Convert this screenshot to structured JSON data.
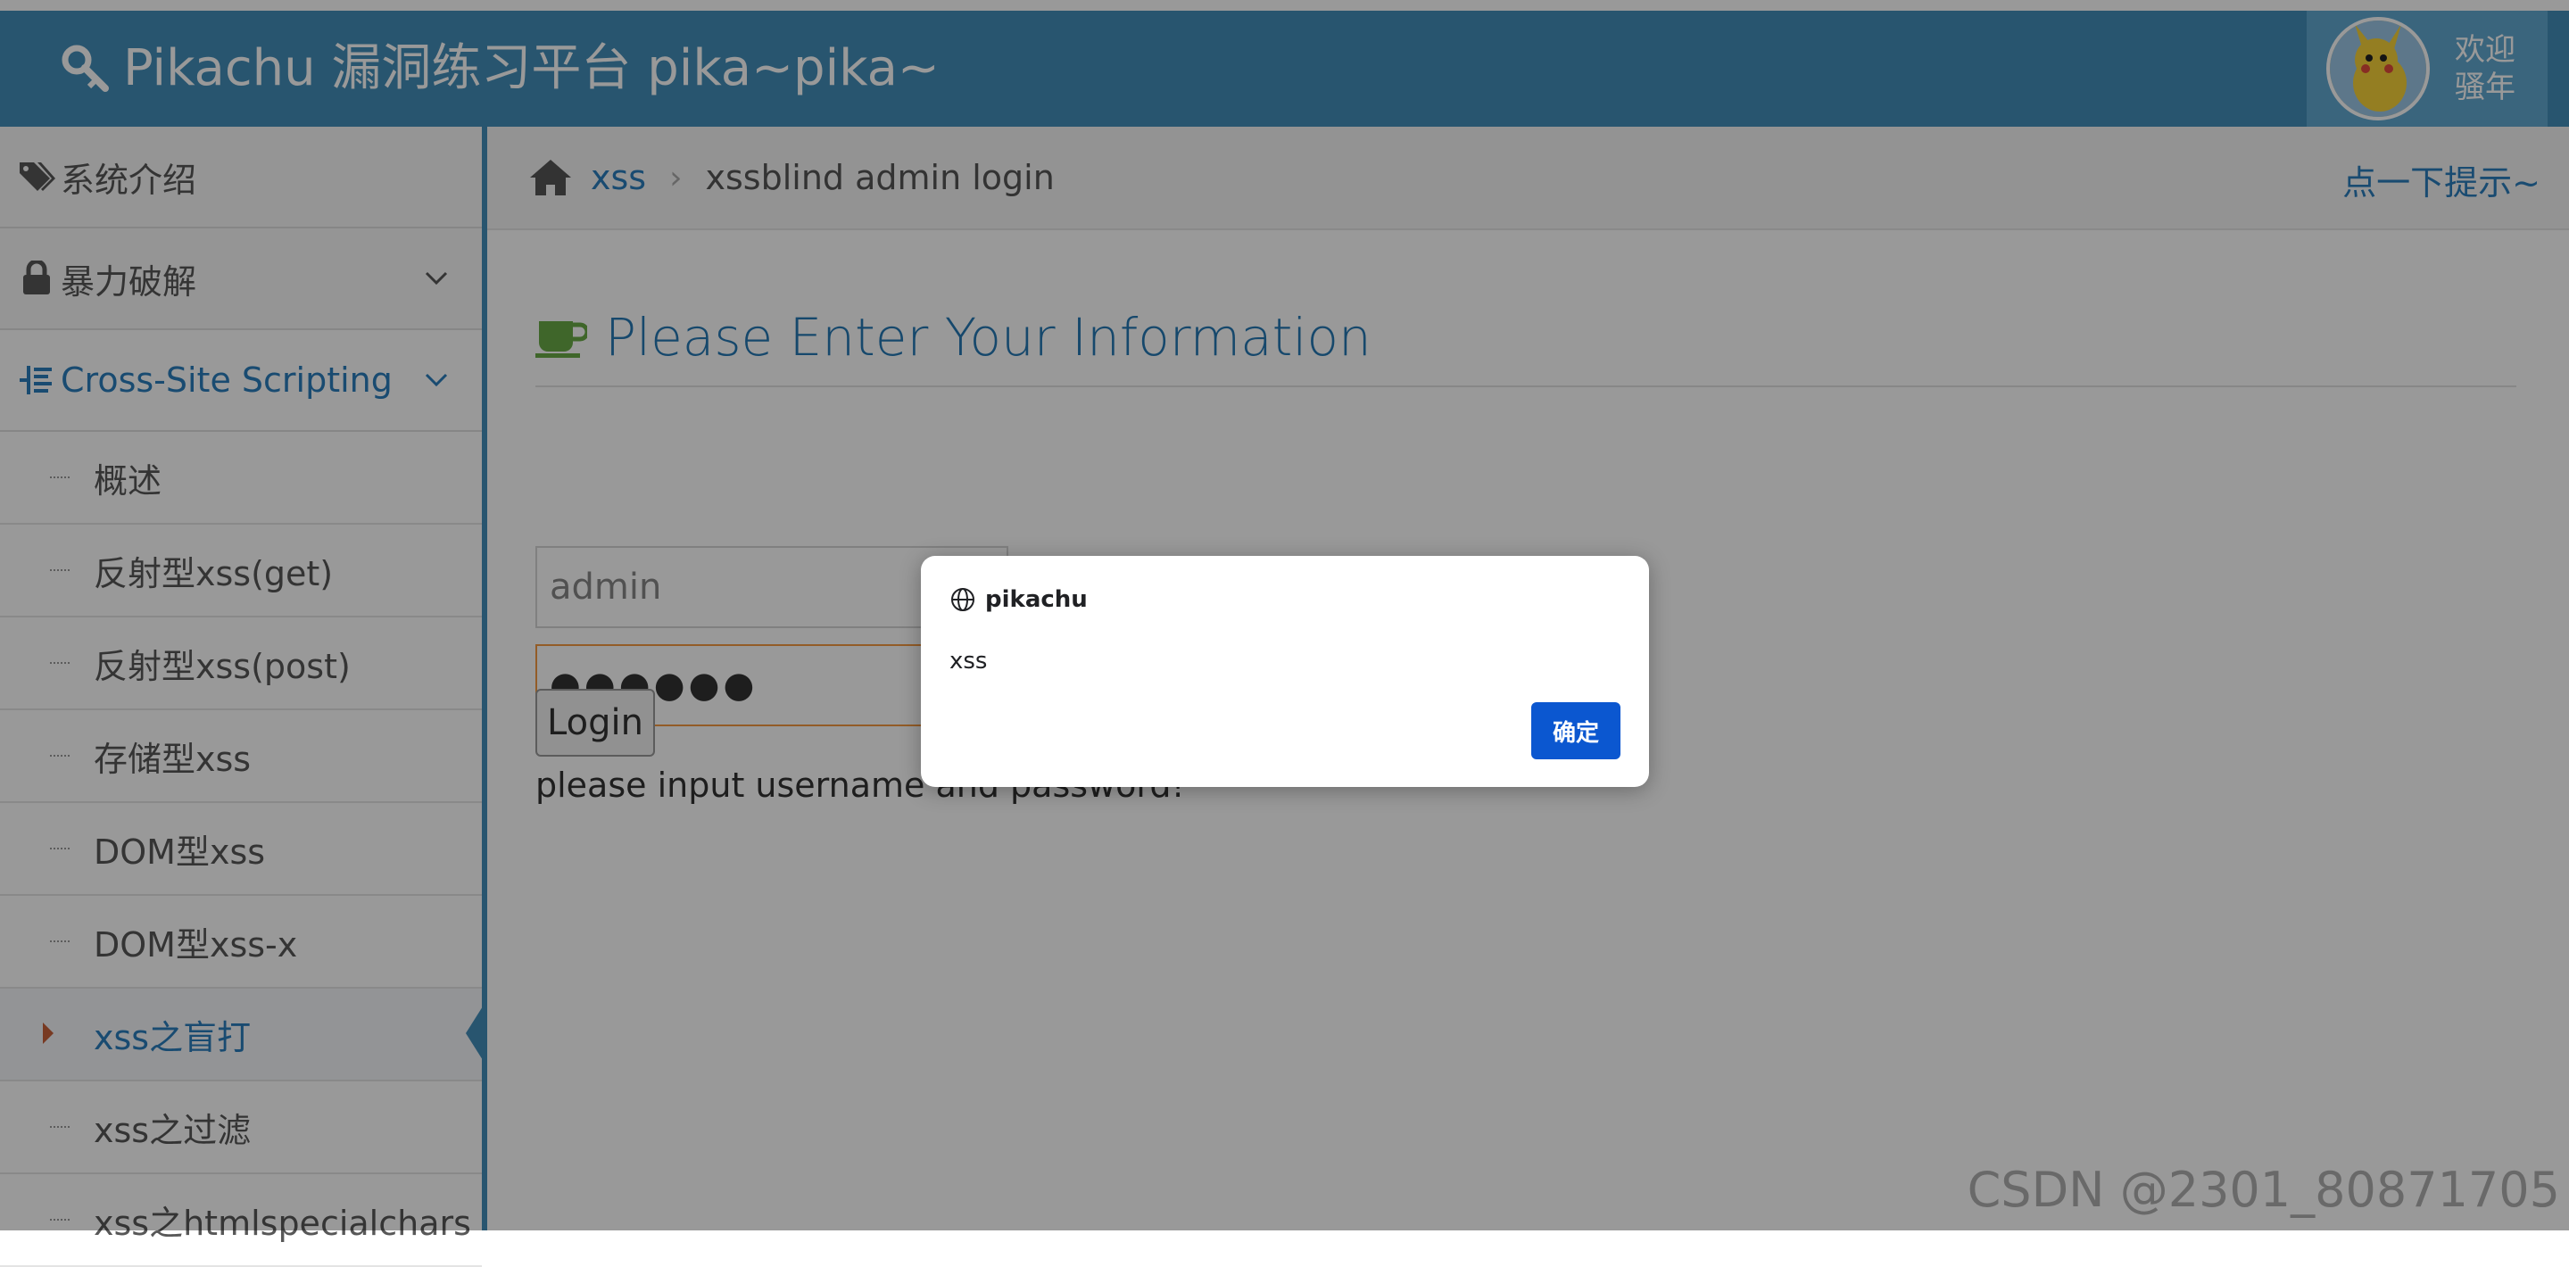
{
  "header": {
    "title": "Pikachu 漏洞练习平台 pika~pika~",
    "welcome_line1": "欢迎",
    "welcome_line2": "骚年"
  },
  "sidebar": {
    "items": [
      {
        "label": "系统介绍",
        "icon": "tags-icon"
      },
      {
        "label": "暴力破解",
        "icon": "lock-icon"
      },
      {
        "label": "Cross-Site Scripting",
        "icon": "list-icon"
      }
    ],
    "subitems": [
      {
        "label": "概述"
      },
      {
        "label": "反射型xss(get)"
      },
      {
        "label": "反射型xss(post)"
      },
      {
        "label": "存储型xss"
      },
      {
        "label": "DOM型xss"
      },
      {
        "label": "DOM型xss-x"
      },
      {
        "label": "xss之盲打"
      },
      {
        "label": "xss之过滤"
      },
      {
        "label": "xss之htmlspecialchars"
      }
    ]
  },
  "breadcrumbs": {
    "home_link": "xss",
    "separator": "›",
    "current": "xssblind admin login",
    "hint": "点一下提示~"
  },
  "form": {
    "title": "Please Enter Your Information",
    "username_value": "admin",
    "password_value": "●●●●●●",
    "login_label": "Login",
    "message": "please input username and password!"
  },
  "watermark": "CSDN @2301_80871705",
  "dialog": {
    "origin": "pikachu",
    "message": "xss",
    "ok_label": "确定"
  },
  "colors": {
    "header_bg": "#438eb9",
    "accent": "#2b7dbc",
    "dialog_button": "#0b57d0"
  }
}
